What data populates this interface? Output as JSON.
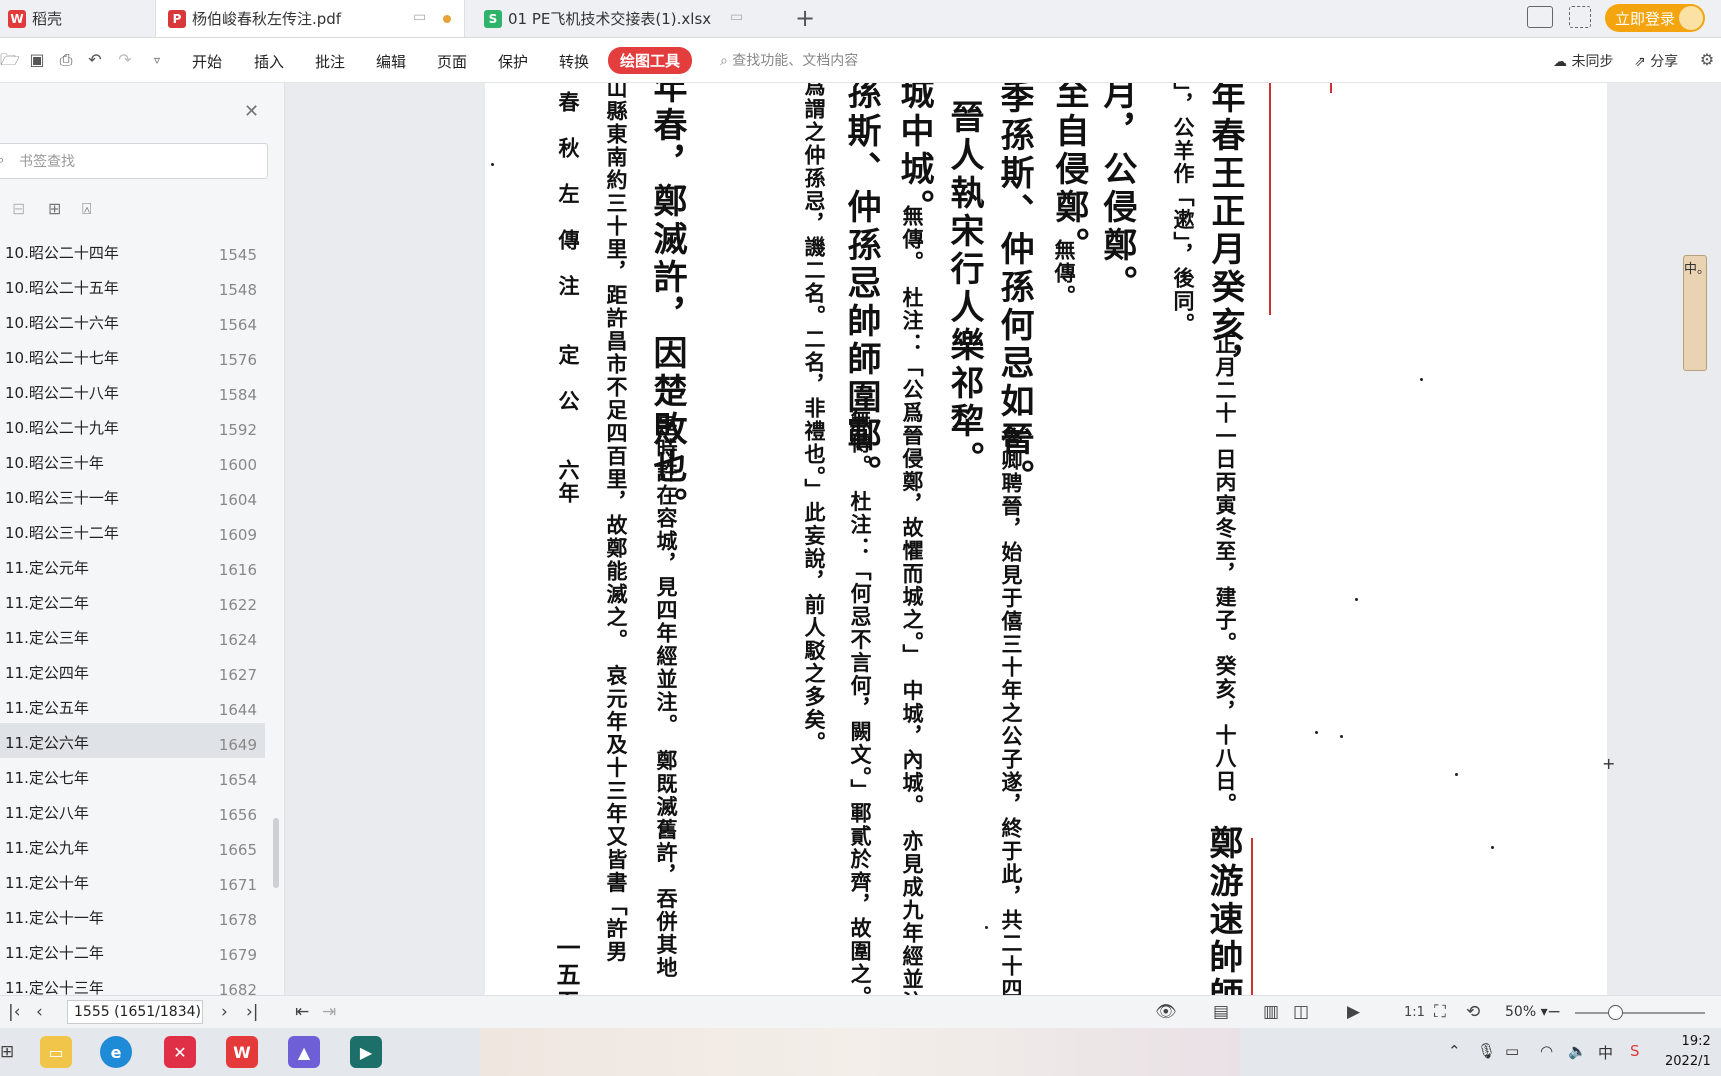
{
  "tabs": [
    {
      "label": "稻壳",
      "icon": "docer-icon"
    },
    {
      "label": "杨伯峻春秋左传注.pdf",
      "icon": "pdf-icon"
    },
    {
      "label": "01 PE飞机技术交接表(1).xlsx",
      "icon": "xlsx-icon"
    }
  ],
  "login_label": "立即登录",
  "toolbar": {
    "menus": [
      "开始",
      "插入",
      "批注",
      "编辑",
      "页面",
      "保护",
      "转换"
    ],
    "active_menu": "绘图工具",
    "search_placeholder": "查找功能、文档内容",
    "sync_label": "未同步",
    "share_label": "分享"
  },
  "sidebar": {
    "search_placeholder": "书签查找",
    "bookmarks": [
      {
        "label": "10.昭公二十四年",
        "page": "1545"
      },
      {
        "label": "10.昭公二十五年",
        "page": "1548"
      },
      {
        "label": "10.昭公二十六年",
        "page": "1564"
      },
      {
        "label": "10.昭公二十七年",
        "page": "1576"
      },
      {
        "label": "10.昭公二十八年",
        "page": "1584"
      },
      {
        "label": "10.昭公二十九年",
        "page": "1592"
      },
      {
        "label": "10.昭公三十年",
        "page": "1600"
      },
      {
        "label": "10.昭公三十一年",
        "page": "1604"
      },
      {
        "label": "10.昭公三十二年",
        "page": "1609"
      },
      {
        "label": "11.定公元年",
        "page": "1616"
      },
      {
        "label": "11.定公二年",
        "page": "1622"
      },
      {
        "label": "11.定公三年",
        "page": "1624"
      },
      {
        "label": "11.定公四年",
        "page": "1627"
      },
      {
        "label": "11.定公五年",
        "page": "1644"
      },
      {
        "label": "11.定公六年",
        "page": "1649"
      },
      {
        "label": "11.定公七年",
        "page": "1654"
      },
      {
        "label": "11.定公八年",
        "page": "1656"
      },
      {
        "label": "11.定公九年",
        "page": "1665"
      },
      {
        "label": "11.定公十年",
        "page": "1671"
      },
      {
        "label": "11.定公十一年",
        "page": "1678"
      },
      {
        "label": "11.定公十二年",
        "page": "1679"
      },
      {
        "label": "11.定公十三年",
        "page": "1682"
      }
    ],
    "selected_index": 14
  },
  "document": {
    "columns": [
      {
        "text": "年春王正月癸亥，",
        "size": "big"
      },
      {
        "text": "正月二十一日丙寅冬至，建子。癸亥，十八日。",
        "size": "sml"
      },
      {
        "text": "鄭游速帥師",
        "size": "big"
      },
      {
        "text": "」，公羊作「遬」，後同。",
        "size": "sml"
      },
      {
        "text": "月，公侵鄭。",
        "size": "big"
      },
      {
        "text": "至自侵鄭。",
        "size": "big"
      },
      {
        "text": "無傳。",
        "size": "sml"
      },
      {
        "text": "季孫斯、仲孫何忌如晉。",
        "size": "big"
      },
      {
        "text": "魯卿聘晉，始見于僖三十年之公子遂，終于此，共二十四",
        "size": "sml"
      },
      {
        "text": "晉人執宋行人樂祁犂。",
        "size": "big"
      },
      {
        "text": "城中城。",
        "size": "big"
      },
      {
        "text": "無傳。　杜注：「公爲晉侵鄭，故懼而城之。」　中城，內城。　亦見成九年經並注",
        "size": "sml"
      },
      {
        "text": "孫斯、仲孫忌帥師圍鄆。",
        "size": "big"
      },
      {
        "text": "無傳。　杜注：「何忌不言何，闕文。」鄆貳於齊，故圍之。",
        "size": "sml"
      },
      {
        "text": "爲謂之仲孫忌，譏二名。二名，非禮也。」此妄說，前人駁之多矣。",
        "size": "sml"
      },
      {
        "text": "年春，鄭滅許，因楚敗也。",
        "size": "big"
      },
      {
        "text": "是時許在容城，見四年經並注。　鄭既滅舊許，吞併其地",
        "size": "sml"
      },
      {
        "text": "山縣東南約三十里，距許昌市不足四百里，故鄭能滅之。　哀元年及十三年又皆書「許男",
        "size": "sml"
      },
      {
        "text": "春　秋　左　傳　注　　定　公　　六年",
        "size": "sml"
      },
      {
        "text": "一五五",
        "size": "mid"
      }
    ],
    "widget_chars": "中。"
  },
  "statusbar": {
    "page_indicator": "1555 (1651/1834)",
    "zoom": "50%"
  },
  "clock": {
    "time": "19:2",
    "date": "2022/1"
  },
  "colors": {
    "accent_red": "#e43d3d",
    "login_orange": "#f3a40f",
    "xlsx_green": "#2fb36b",
    "pdf_red": "#d9383a"
  }
}
